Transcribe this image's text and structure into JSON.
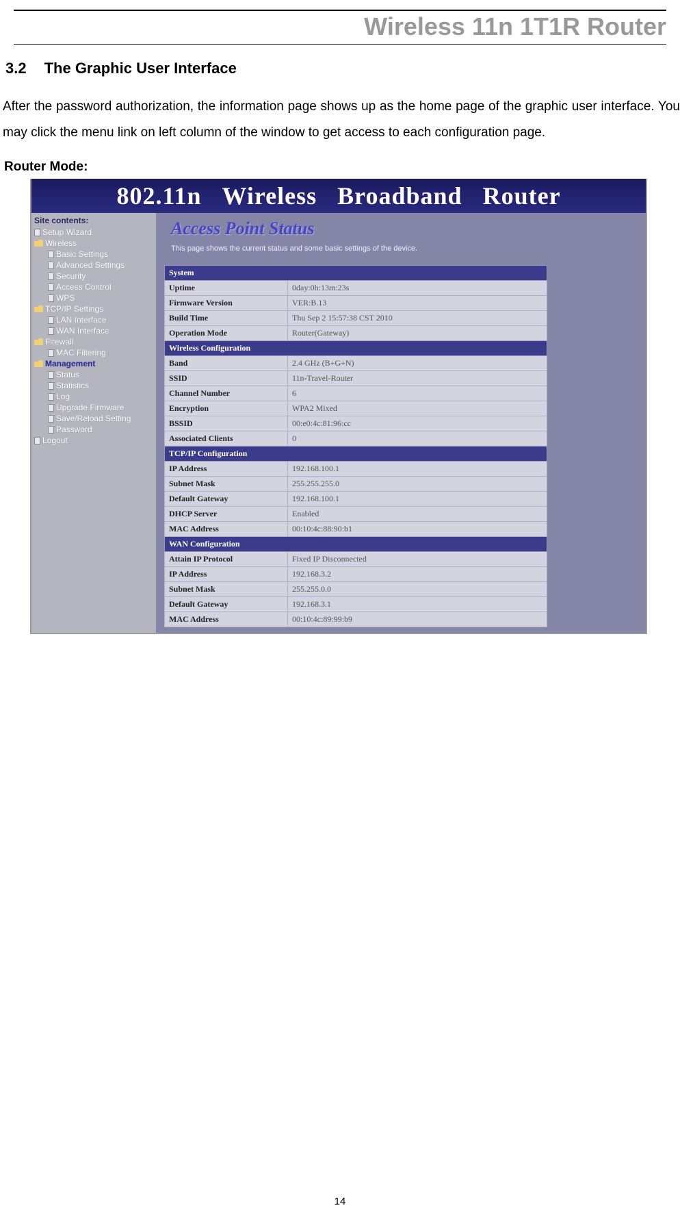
{
  "header": {
    "title": "Wireless 11n 1T1R Router"
  },
  "section": {
    "number": "3.2",
    "title": "The Graphic User Interface",
    "body": "After the password authorization, the information page shows up as the home page of the graphic user interface. You may click the menu link on left column of the window to get access to each configuration page.",
    "sub": "Router Mode:"
  },
  "banner": {
    "a": "802.11n",
    "b": "Wireless",
    "c": "Broadband",
    "d": "Router"
  },
  "sidebar": {
    "title": "Site contents:",
    "items": [
      {
        "label": "Setup Wizard",
        "lvl": 1,
        "icon": "page"
      },
      {
        "label": "Wireless",
        "lvl": 1,
        "icon": "folder-open"
      },
      {
        "label": "Basic Settings",
        "lvl": 2,
        "icon": "page"
      },
      {
        "label": "Advanced Settings",
        "lvl": 2,
        "icon": "page"
      },
      {
        "label": "Security",
        "lvl": 2,
        "icon": "page"
      },
      {
        "label": "Access Control",
        "lvl": 2,
        "icon": "page"
      },
      {
        "label": "WPS",
        "lvl": 2,
        "icon": "page"
      },
      {
        "label": "TCP/IP Settings",
        "lvl": 1,
        "icon": "folder-open"
      },
      {
        "label": "LAN Interface",
        "lvl": 2,
        "icon": "page"
      },
      {
        "label": "WAN Interface",
        "lvl": 2,
        "icon": "page"
      },
      {
        "label": "Firewall",
        "lvl": 1,
        "icon": "folder-open"
      },
      {
        "label": "MAC Filtering",
        "lvl": 2,
        "icon": "page"
      },
      {
        "label": "Management",
        "lvl": 1,
        "icon": "folder-open",
        "highlight": true
      },
      {
        "label": "Status",
        "lvl": 2,
        "icon": "page"
      },
      {
        "label": "Statistics",
        "lvl": 2,
        "icon": "page"
      },
      {
        "label": "Log",
        "lvl": 2,
        "icon": "page"
      },
      {
        "label": "Upgrade Firmware",
        "lvl": 2,
        "icon": "page"
      },
      {
        "label": "Save/Reload Setting",
        "lvl": 2,
        "icon": "page"
      },
      {
        "label": "Password",
        "lvl": 2,
        "icon": "page"
      },
      {
        "label": "Logout",
        "lvl": 1,
        "icon": "page"
      }
    ]
  },
  "main": {
    "title": "Access Point Status",
    "desc": "This page shows the current status and some basic settings of the device.",
    "sections": [
      {
        "header": "System",
        "rows": [
          {
            "k": "Uptime",
            "v": "0day:0h:13m:23s"
          },
          {
            "k": "Firmware Version",
            "v": "VER:B.13"
          },
          {
            "k": "Build Time",
            "v": "Thu Sep 2 15:57:38 CST 2010"
          },
          {
            "k": "Operation Mode",
            "v": "Router(Gateway)"
          }
        ]
      },
      {
        "header": "Wireless Configuration",
        "rows": [
          {
            "k": "Band",
            "v": "2.4 GHz (B+G+N)"
          },
          {
            "k": "SSID",
            "v": "11n-Travel-Router"
          },
          {
            "k": "Channel Number",
            "v": "6"
          },
          {
            "k": "Encryption",
            "v": "WPA2 Mixed"
          },
          {
            "k": "BSSID",
            "v": "00:e0:4c:81:96:cc"
          },
          {
            "k": "Associated Clients",
            "v": "0"
          }
        ]
      },
      {
        "header": "TCP/IP Configuration",
        "rows": [
          {
            "k": "IP Address",
            "v": "192.168.100.1"
          },
          {
            "k": "Subnet Mask",
            "v": "255.255.255.0"
          },
          {
            "k": "Default Gateway",
            "v": "192.168.100.1"
          },
          {
            "k": "DHCP Server",
            "v": "Enabled"
          },
          {
            "k": "MAC Address",
            "v": "00:10:4c:88:90:b1"
          }
        ]
      },
      {
        "header": "WAN Configuration",
        "rows": [
          {
            "k": "Attain IP Protocol",
            "v": "Fixed IP Disconnected"
          },
          {
            "k": "IP Address",
            "v": "192.168.3.2"
          },
          {
            "k": "Subnet Mask",
            "v": "255.255.0.0"
          },
          {
            "k": "Default Gateway",
            "v": "192.168.3.1"
          },
          {
            "k": "MAC Address",
            "v": "00:10:4c:89:99:b9"
          }
        ]
      }
    ]
  },
  "page_number": "14"
}
